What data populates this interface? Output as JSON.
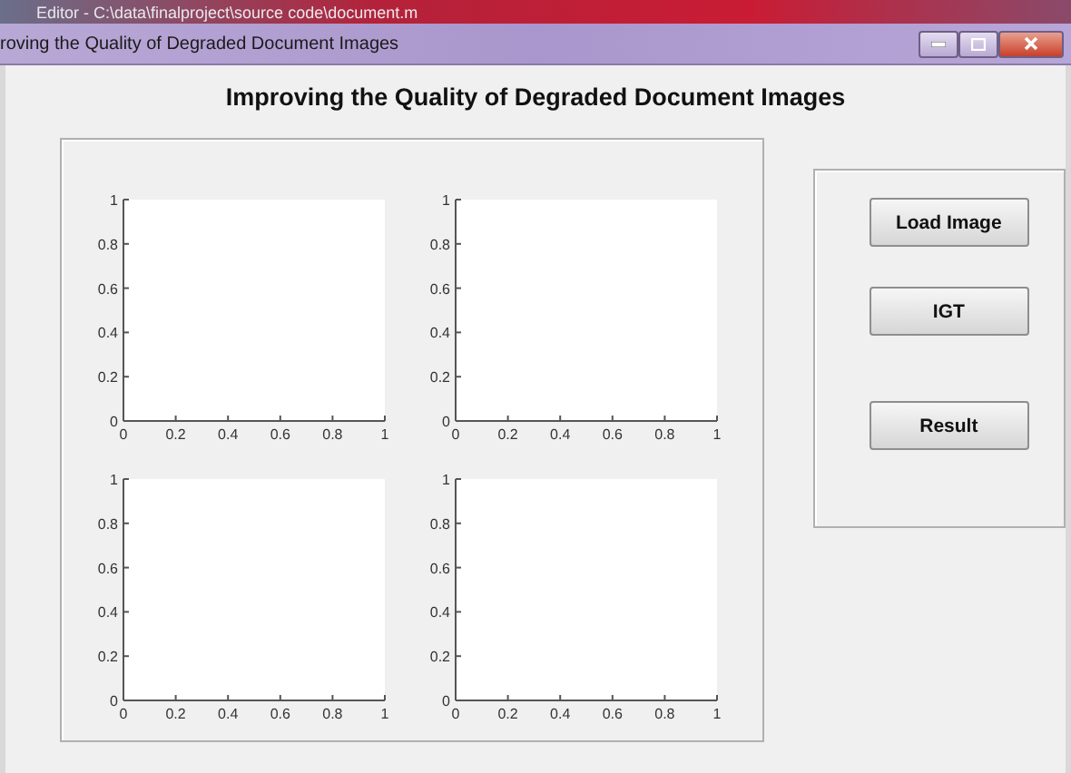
{
  "background_window": {
    "title": "Editor - C:\\data\\finalproject\\source code\\document.m"
  },
  "window": {
    "title": "roving the Quality of Degraded Document Images"
  },
  "heading": "Improving the Quality of Degraded Document Images",
  "axes": [
    {
      "chart_data": {
        "type": "line",
        "xlim": [
          0,
          1
        ],
        "ylim": [
          0,
          1
        ],
        "xticks": [
          0,
          0.2,
          0.4,
          0.6,
          0.8,
          1
        ],
        "yticks": [
          0,
          0.2,
          0.4,
          0.6,
          0.8,
          1
        ]
      }
    },
    {
      "chart_data": {
        "type": "line",
        "xlim": [
          0,
          1
        ],
        "ylim": [
          0,
          1
        ],
        "xticks": [
          0,
          0.2,
          0.4,
          0.6,
          0.8,
          1
        ],
        "yticks": [
          0,
          0.2,
          0.4,
          0.6,
          0.8,
          1
        ]
      }
    },
    {
      "chart_data": {
        "type": "line",
        "xlim": [
          0,
          1
        ],
        "ylim": [
          0,
          1
        ],
        "xticks": [
          0,
          0.2,
          0.4,
          0.6,
          0.8,
          1
        ],
        "yticks": [
          0,
          0.2,
          0.4,
          0.6,
          0.8,
          1
        ]
      }
    },
    {
      "chart_data": {
        "type": "line",
        "xlim": [
          0,
          1
        ],
        "ylim": [
          0,
          1
        ],
        "xticks": [
          0,
          0.2,
          0.4,
          0.6,
          0.8,
          1
        ],
        "yticks": [
          0,
          0.2,
          0.4,
          0.6,
          0.8,
          1
        ]
      }
    }
  ],
  "buttons": [
    "Load Image",
    "IGT",
    "Result"
  ]
}
